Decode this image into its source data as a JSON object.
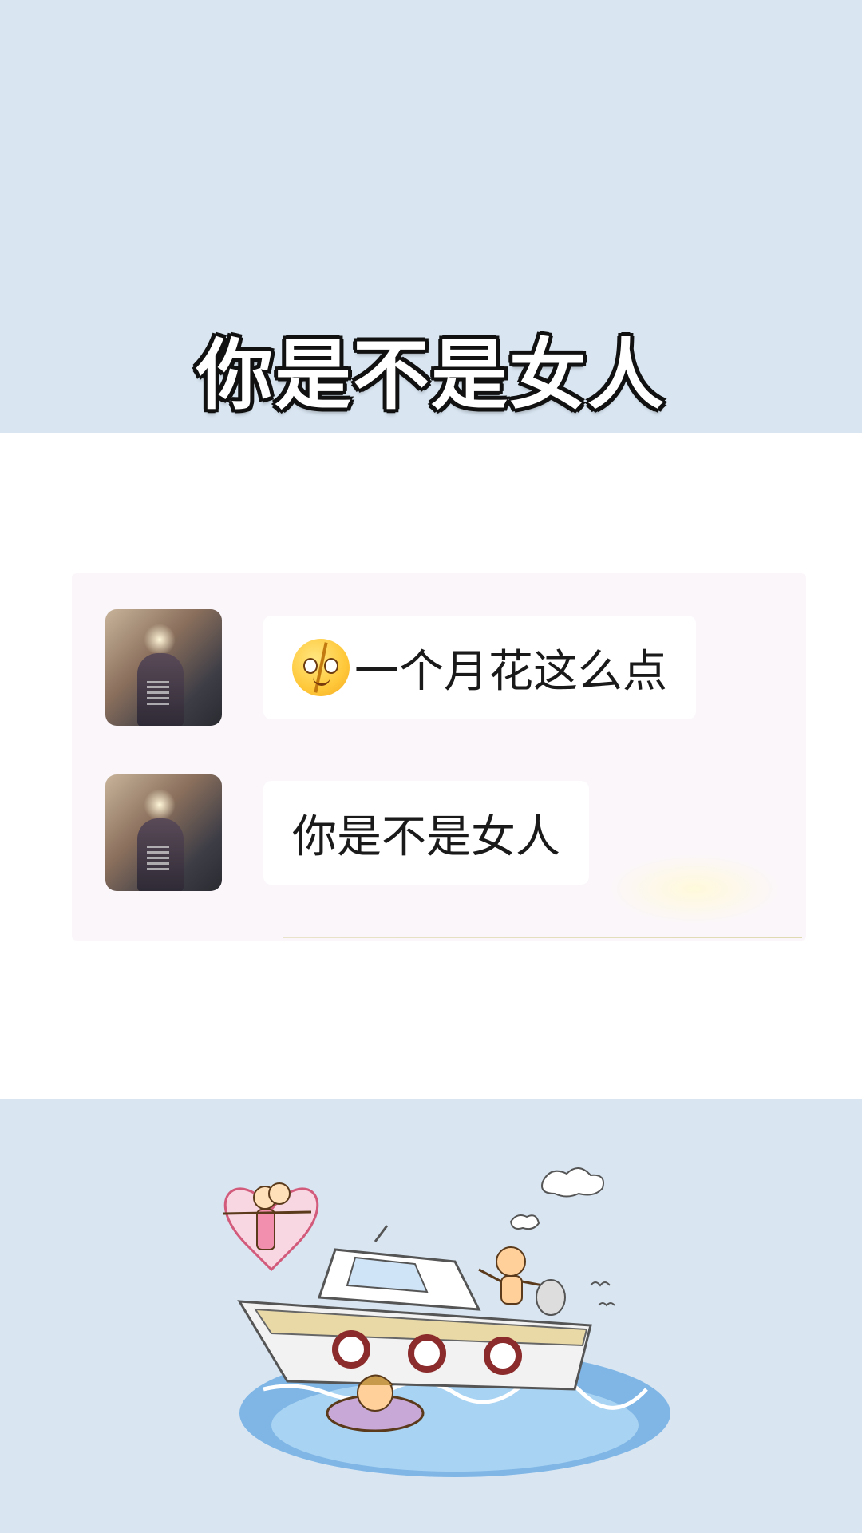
{
  "title": "你是不是女人",
  "messages": [
    {
      "avatar": "user-avatar",
      "emoji": "broken-heart-face-emoji",
      "text": "一个月花这么点"
    },
    {
      "avatar": "user-avatar",
      "text": "你是不是女人"
    }
  ],
  "illustration": "cartoon-boat-scene",
  "colors": {
    "background": "#d9e6f2",
    "panel": "#ffffff",
    "bubble": "#ffffff",
    "title_fill": "#ffffff",
    "title_outline": "#111111"
  }
}
